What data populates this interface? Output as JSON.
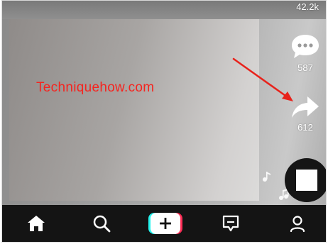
{
  "overlay": {
    "watermark": "Techniquehow.com",
    "likes_count": "42.2k"
  },
  "actions": {
    "comment": {
      "icon": "comment-bubble-icon",
      "count": "587"
    },
    "share": {
      "icon": "share-arrow-icon",
      "count": "612"
    },
    "music_icon": "music-notes-icon",
    "sound_disc_icon": "sound-disc-icon"
  },
  "annotation": {
    "icon": "red-pointer-arrow",
    "color": "#e8221b"
  },
  "bottom_nav": {
    "items": [
      {
        "icon": "home-icon"
      },
      {
        "icon": "search-icon"
      },
      {
        "icon": "create-plus-icon"
      },
      {
        "icon": "inbox-icon"
      },
      {
        "icon": "profile-icon"
      }
    ]
  },
  "colors": {
    "accent_cyan": "#25f4ee",
    "accent_pink": "#fe2c55",
    "nav_background": "#141414",
    "watermark": "#f5241f"
  }
}
